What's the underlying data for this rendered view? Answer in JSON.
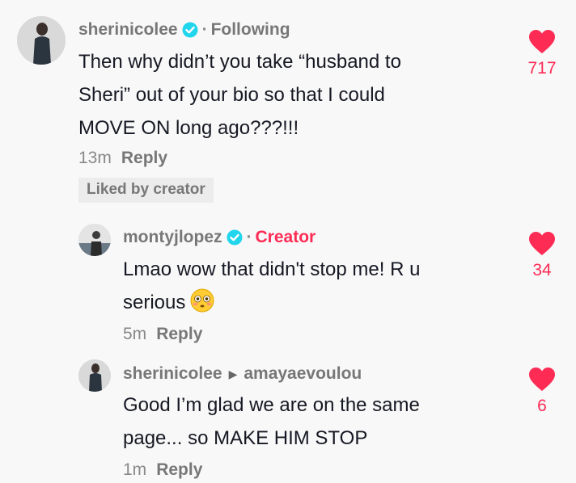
{
  "comments": [
    {
      "username": "sherinicolee",
      "separator": "·",
      "relation": "Following",
      "text_lines": [
        "Then why didn’t you take “husband to",
        "Sheri” out of your bio so that I could",
        "MOVE ON long ago???!!!"
      ],
      "time": "13m",
      "reply_label": "Reply",
      "badge": "Liked by creator",
      "likes": "717"
    },
    {
      "username": "montyjlopez",
      "separator": "·",
      "relation": "Creator",
      "text_lines": [
        "Lmao wow that didn't stop me! R u",
        "serious"
      ],
      "emoji": "flushed-face-emoji",
      "time": "5m",
      "reply_label": "Reply",
      "likes": "34"
    },
    {
      "username": "sherinicolee",
      "reply_arrow": "▶",
      "reply_to": "amayaevoulou",
      "text_lines": [
        "Good I’m glad we are on the same",
        "page... so MAKE HIM STOP"
      ],
      "time": "1m",
      "reply_label": "Reply",
      "likes": "6"
    }
  ],
  "colors": {
    "accent": "#fe2c55",
    "verified": "#20d5ec",
    "background": "#f8f8f8"
  }
}
